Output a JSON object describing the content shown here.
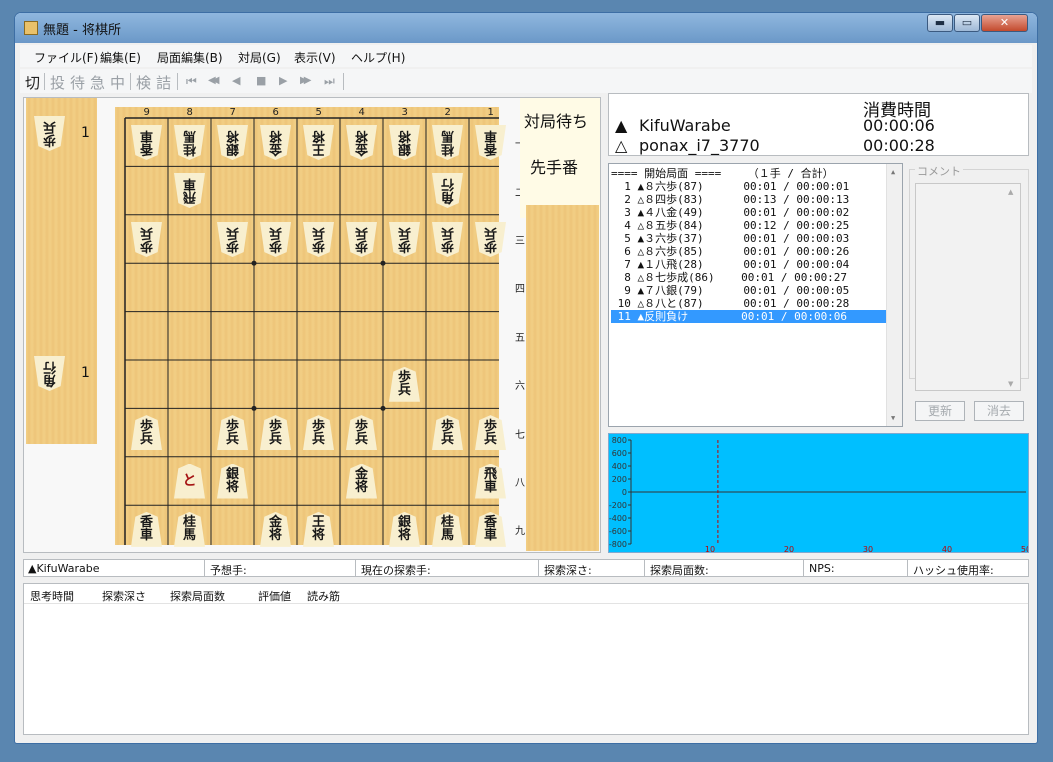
{
  "window": {
    "title": "無題 - 将棋所",
    "buttons": {
      "minimize": "▬",
      "maximize": "▭",
      "close": "✕"
    }
  },
  "menu": [
    {
      "label": "ファイル(F)"
    },
    {
      "label": "編集(E)"
    },
    {
      "label": "局面編集(B)"
    },
    {
      "label": "対局(G)"
    },
    {
      "label": "表示(V)"
    },
    {
      "label": "ヘルプ(H)"
    }
  ],
  "toolbar": {
    "items": [
      "切",
      "投",
      "待",
      "急",
      "中",
      "検",
      "詰"
    ],
    "enabled": [
      true,
      false,
      false,
      false,
      false,
      false,
      false
    ],
    "nav": [
      "⏮",
      "◀◀",
      "◀",
      "■",
      "▶",
      "▶▶",
      "⏭"
    ]
  },
  "board": {
    "files": [
      "9",
      "8",
      "7",
      "6",
      "5",
      "4",
      "3",
      "2",
      "1"
    ],
    "ranks": [
      "一",
      "二",
      "三",
      "四",
      "五",
      "六",
      "七",
      "八",
      "九"
    ],
    "pieces": [
      {
        "file": 9,
        "rank": 1,
        "text": "香車",
        "side": "gote"
      },
      {
        "file": 8,
        "rank": 1,
        "text": "桂馬",
        "side": "gote"
      },
      {
        "file": 7,
        "rank": 1,
        "text": "銀将",
        "side": "gote"
      },
      {
        "file": 6,
        "rank": 1,
        "text": "金将",
        "side": "gote"
      },
      {
        "file": 5,
        "rank": 1,
        "text": "王将",
        "side": "gote"
      },
      {
        "file": 4,
        "rank": 1,
        "text": "金将",
        "side": "gote"
      },
      {
        "file": 3,
        "rank": 1,
        "text": "銀将",
        "side": "gote"
      },
      {
        "file": 2,
        "rank": 1,
        "text": "桂馬",
        "side": "gote"
      },
      {
        "file": 1,
        "rank": 1,
        "text": "香車",
        "side": "gote"
      },
      {
        "file": 8,
        "rank": 2,
        "text": "飛車",
        "side": "gote"
      },
      {
        "file": 2,
        "rank": 2,
        "text": "角行",
        "side": "gote"
      },
      {
        "file": 9,
        "rank": 3,
        "text": "歩兵",
        "side": "gote"
      },
      {
        "file": 7,
        "rank": 3,
        "text": "歩兵",
        "side": "gote"
      },
      {
        "file": 6,
        "rank": 3,
        "text": "歩兵",
        "side": "gote"
      },
      {
        "file": 5,
        "rank": 3,
        "text": "歩兵",
        "side": "gote"
      },
      {
        "file": 4,
        "rank": 3,
        "text": "歩兵",
        "side": "gote"
      },
      {
        "file": 3,
        "rank": 3,
        "text": "歩兵",
        "side": "gote"
      },
      {
        "file": 2,
        "rank": 3,
        "text": "歩兵",
        "side": "gote"
      },
      {
        "file": 1,
        "rank": 3,
        "text": "歩兵",
        "side": "gote"
      },
      {
        "file": 3,
        "rank": 6,
        "text": "歩兵",
        "side": "sente"
      },
      {
        "file": 9,
        "rank": 7,
        "text": "歩兵",
        "side": "sente"
      },
      {
        "file": 7,
        "rank": 7,
        "text": "歩兵",
        "side": "sente"
      },
      {
        "file": 6,
        "rank": 7,
        "text": "歩兵",
        "side": "sente"
      },
      {
        "file": 5,
        "rank": 7,
        "text": "歩兵",
        "side": "sente"
      },
      {
        "file": 4,
        "rank": 7,
        "text": "歩兵",
        "side": "sente"
      },
      {
        "file": 2,
        "rank": 7,
        "text": "歩兵",
        "side": "sente"
      },
      {
        "file": 1,
        "rank": 7,
        "text": "歩兵",
        "side": "sente"
      },
      {
        "file": 8,
        "rank": 8,
        "text": "と",
        "side": "sente",
        "promoted": true
      },
      {
        "file": 7,
        "rank": 8,
        "text": "銀将",
        "side": "sente"
      },
      {
        "file": 4,
        "rank": 8,
        "text": "金将",
        "side": "sente"
      },
      {
        "file": 1,
        "rank": 8,
        "text": "飛車",
        "side": "sente"
      },
      {
        "file": 9,
        "rank": 9,
        "text": "香車",
        "side": "sente"
      },
      {
        "file": 8,
        "rank": 9,
        "text": "桂馬",
        "side": "sente"
      },
      {
        "file": 6,
        "rank": 9,
        "text": "金将",
        "side": "sente"
      },
      {
        "file": 5,
        "rank": 9,
        "text": "王将",
        "side": "sente"
      },
      {
        "file": 3,
        "rank": 9,
        "text": "銀将",
        "side": "sente"
      },
      {
        "file": 2,
        "rank": 9,
        "text": "桂馬",
        "side": "sente"
      },
      {
        "file": 1,
        "rank": 9,
        "text": "香車",
        "side": "sente"
      }
    ]
  },
  "hands": {
    "gote": [
      {
        "text": "歩兵",
        "count": "1"
      },
      {
        "text": "角行",
        "count": "1"
      }
    ]
  },
  "status": {
    "waiting": "対局待ち",
    "turn": "先手番"
  },
  "time_panel": {
    "header": "消費時間",
    "players": [
      {
        "mark": "▲",
        "name": "KifuWarabe",
        "time": "00:00:06"
      },
      {
        "mark": "△",
        "name": "ponax_i7_3770",
        "time": "00:00:28"
      }
    ]
  },
  "kifu": {
    "header": "==== 開始局面 ====    （１手 / 合計）",
    "rows": [
      {
        "text": "  1 ▲８六歩(87)      00:01 / 00:00:01"
      },
      {
        "text": "  2 △８四歩(83)      00:13 / 00:00:13"
      },
      {
        "text": "  3 ▲４八金(49)      00:01 / 00:00:02"
      },
      {
        "text": "  4 △８五歩(84)      00:12 / 00:00:25"
      },
      {
        "text": "  5 ▲３六歩(37)      00:01 / 00:00:03"
      },
      {
        "text": "  6 △８六歩(85)      00:01 / 00:00:26"
      },
      {
        "text": "  7 ▲１八飛(28)      00:01 / 00:00:04"
      },
      {
        "text": "  8 △８七歩成(86)    00:01 / 00:00:27"
      },
      {
        "text": "  9 ▲７八銀(79)      00:01 / 00:00:05"
      },
      {
        "text": " 10 △８八と(87)      00:01 / 00:00:28"
      },
      {
        "text": " 11 ▲反則負け        00:01 / 00:00:06"
      }
    ],
    "selected_index": 10
  },
  "comment": {
    "label": "コメント",
    "update_button": "更新",
    "clear_button": "消去"
  },
  "graph": {
    "y_ticks": [
      "800",
      "600",
      "400",
      "200",
      "0",
      "-200",
      "-400",
      "-600",
      "-800"
    ],
    "x_ticks": [
      "10",
      "20",
      "30",
      "40",
      "50"
    ],
    "current_move": 11
  },
  "info_bar": [
    {
      "text": "▲KifuWarabe"
    },
    {
      "text": "予想手:"
    },
    {
      "text": "現在の探索手:"
    },
    {
      "text": "探索深さ:"
    },
    {
      "text": "探索局面数:"
    },
    {
      "text": "NPS:"
    },
    {
      "text": "ハッシュ使用率:"
    }
  ],
  "think_columns": [
    "思考時間",
    "探索深さ",
    "探索局面数",
    "評価値",
    "読み筋"
  ],
  "colors": {
    "graph_bg": "#00bfff",
    "selected_row": "#3399ff",
    "board_wood": "#f2cf85"
  }
}
